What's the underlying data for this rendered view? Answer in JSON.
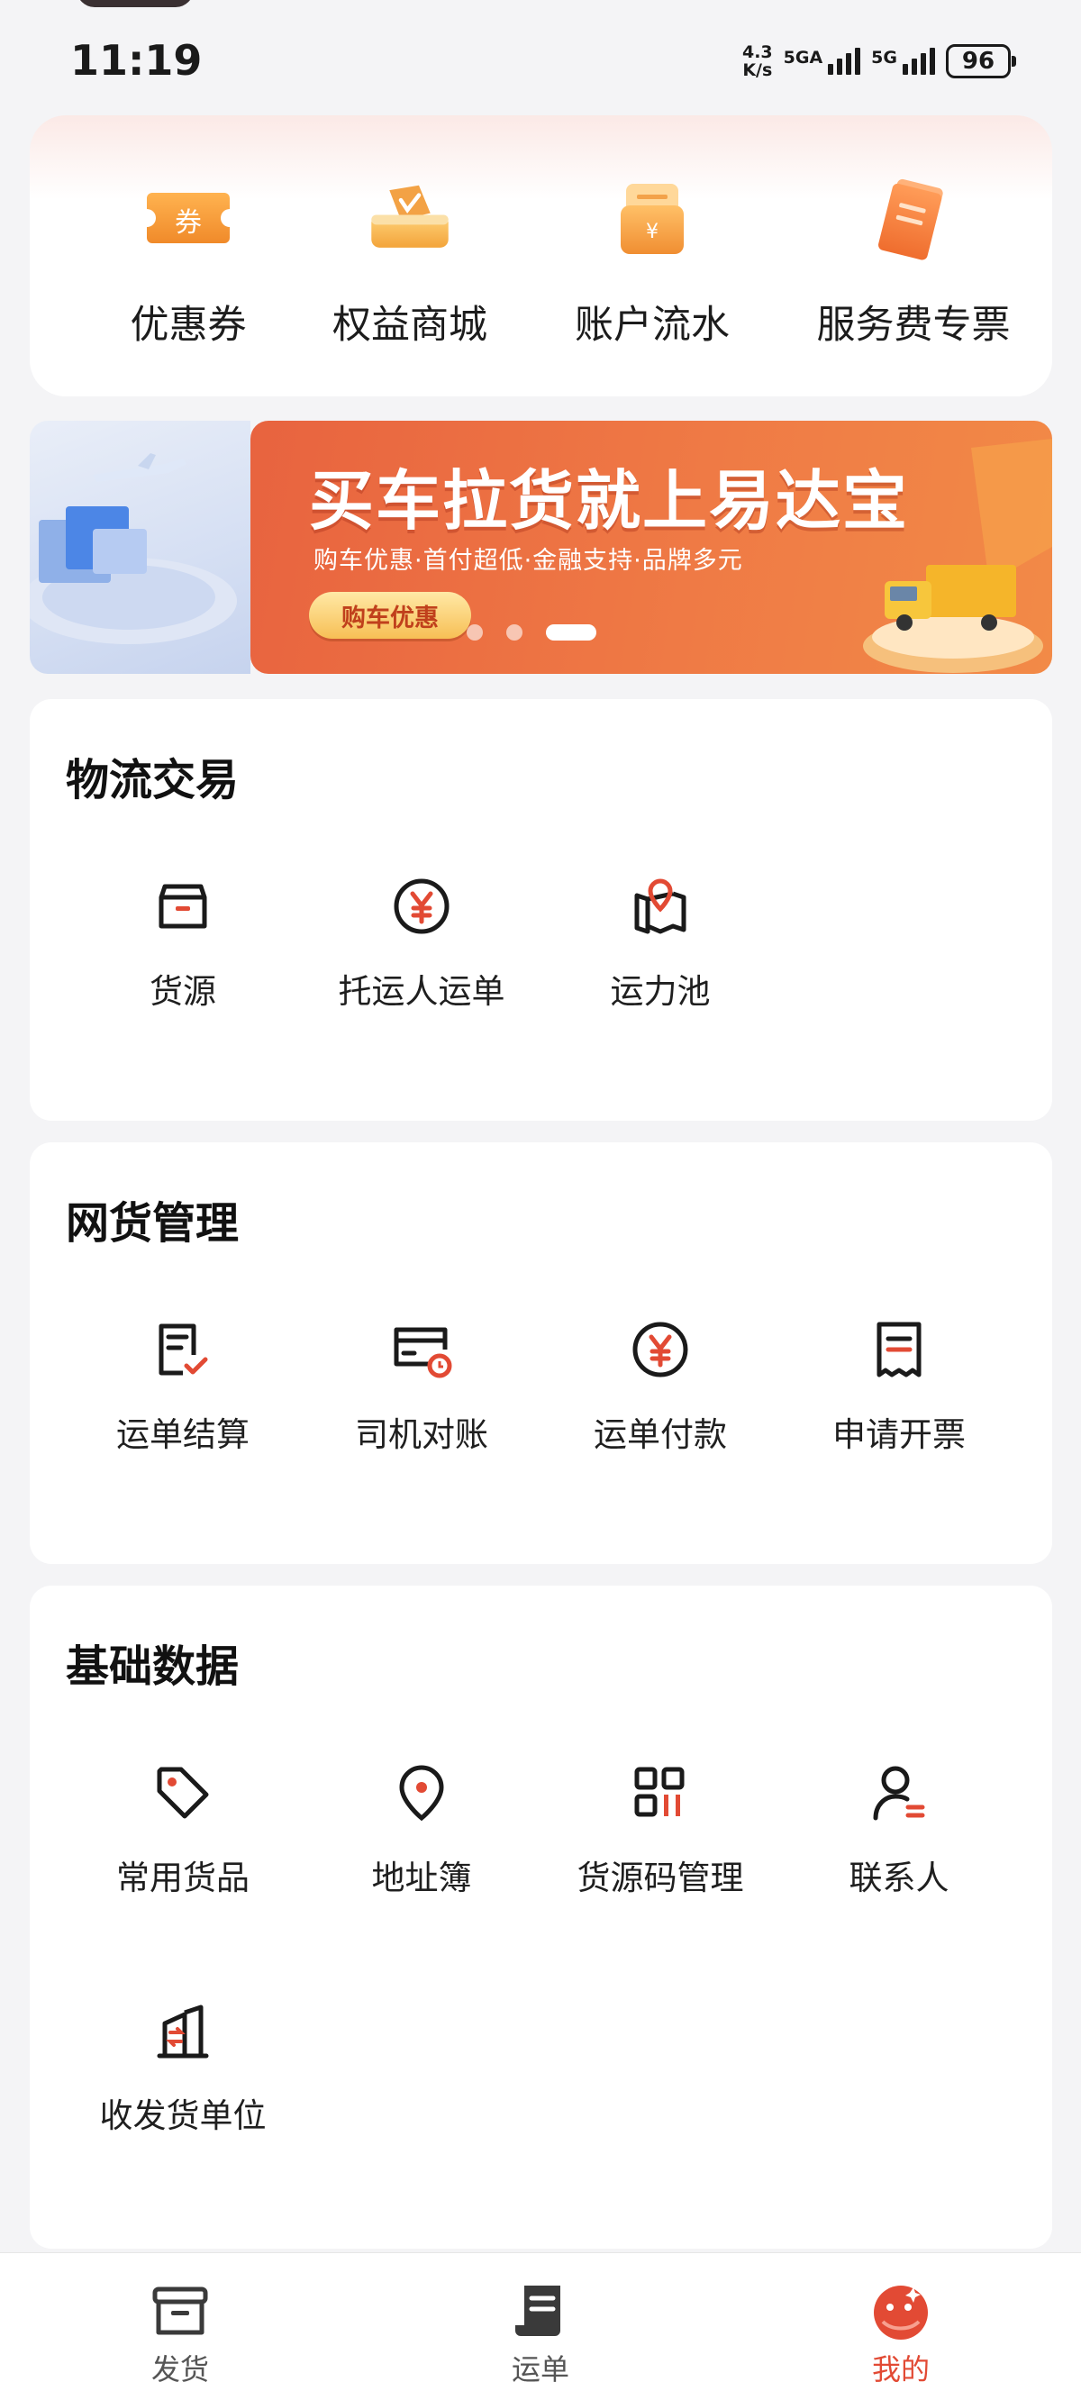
{
  "status_bar": {
    "time": "11:19",
    "net_speed_value": "4.3",
    "net_speed_unit": "K/s",
    "signal1_label": "5GA",
    "signal2_label": "5G",
    "battery": "96"
  },
  "quick_actions": [
    {
      "label": "优惠券",
      "icon_text": "券",
      "icon": "coupon-icon"
    },
    {
      "label": "权益商城",
      "icon": "benefits-mall-icon"
    },
    {
      "label": "账户流水",
      "icon_text": "¥",
      "icon": "account-statement-icon"
    },
    {
      "label": "服务费专票",
      "icon": "service-invoice-icon"
    }
  ],
  "banner": {
    "title": "买车拉货就上易达宝",
    "subtitle": "购车优惠·首付超低·金融支持·品牌多元",
    "button": "购车优惠",
    "active_slide": 3,
    "slide_count": 3
  },
  "sections": [
    {
      "title": "物流交易",
      "items": [
        {
          "label": "货源",
          "icon": "box-icon"
        },
        {
          "label": "托运人运单",
          "icon": "yuan-circle-icon"
        },
        {
          "label": "运力池",
          "icon": "map-pin-icon"
        }
      ]
    },
    {
      "title": "网货管理",
      "items": [
        {
          "label": "运单结算",
          "icon": "document-check-icon"
        },
        {
          "label": "司机对账",
          "icon": "card-clock-icon"
        },
        {
          "label": "运单付款",
          "icon": "yuan-circle-icon"
        },
        {
          "label": "申请开票",
          "icon": "receipt-icon"
        }
      ]
    },
    {
      "title": "基础数据",
      "items": [
        {
          "label": "常用货品",
          "icon": "tag-icon"
        },
        {
          "label": "地址簿",
          "icon": "location-icon"
        },
        {
          "label": "货源码管理",
          "icon": "qr-grid-icon"
        },
        {
          "label": "联系人",
          "icon": "contact-icon"
        },
        {
          "label": "收发货单位",
          "icon": "building-icon"
        }
      ]
    }
  ],
  "tab_bar": {
    "tabs": [
      {
        "label": "发货",
        "icon": "ship-box-icon",
        "active": false
      },
      {
        "label": "运单",
        "icon": "waybill-icon",
        "active": false
      },
      {
        "label": "我的",
        "icon": "profile-face-icon",
        "active": true
      }
    ]
  },
  "colors": {
    "accent": "#e24a34",
    "banner": "#ec6d42",
    "background": "#f4f4f6"
  }
}
